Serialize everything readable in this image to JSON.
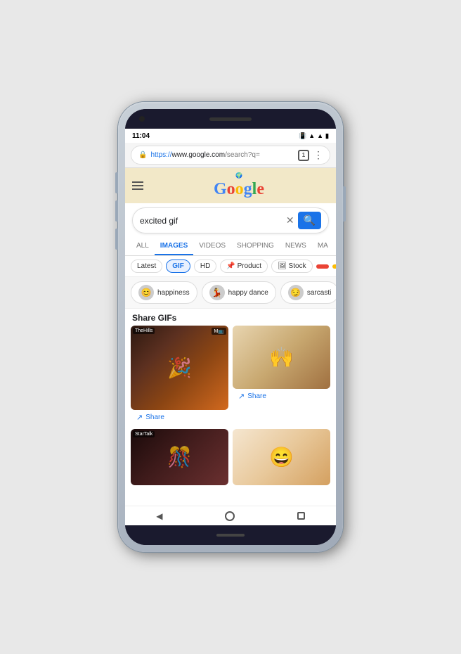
{
  "phone": {
    "status_bar": {
      "time": "11:04",
      "icons": [
        "sim",
        "clipboard",
        "download",
        "dot"
      ]
    },
    "browser": {
      "url_protocol": "https://",
      "url_domain": "www.google.com",
      "url_path": "/search?q=",
      "tab_count": "1"
    },
    "google": {
      "logo_letters": [
        "G",
        "o",
        "o",
        "g",
        "l",
        "e"
      ],
      "search_query": "excited gif",
      "search_placeholder": "Search"
    },
    "tabs": [
      {
        "label": "ALL",
        "active": false
      },
      {
        "label": "IMAGES",
        "active": true
      },
      {
        "label": "VIDEOS",
        "active": false
      },
      {
        "label": "SHOPPING",
        "active": false
      },
      {
        "label": "NEWS",
        "active": false
      },
      {
        "label": "MA",
        "active": false
      }
    ],
    "filters": [
      {
        "label": "Latest",
        "active": false
      },
      {
        "label": "GIF",
        "active": true
      },
      {
        "label": "HD",
        "active": false
      },
      {
        "label": "Product",
        "active": false,
        "has_icon": true
      },
      {
        "label": "Stock",
        "active": false,
        "has_icon": true
      }
    ],
    "related": [
      {
        "label": "happiness",
        "emoji": "😊"
      },
      {
        "label": "happy dance",
        "emoji": "💃"
      },
      {
        "label": "sarcasti",
        "emoji": "😏"
      }
    ],
    "results": {
      "section_title": "Share GIFs",
      "gifs": [
        {
          "source": "TheHills",
          "has_mtv": true,
          "share_label": "Share"
        },
        {
          "source": "",
          "share_label": "Share"
        },
        {
          "source": "StarTalk",
          "has_mtv": false,
          "share_label": ""
        },
        {
          "source": "",
          "share_label": ""
        }
      ]
    },
    "nav": {
      "back_label": "◀",
      "home_label": "",
      "recents_label": ""
    }
  }
}
